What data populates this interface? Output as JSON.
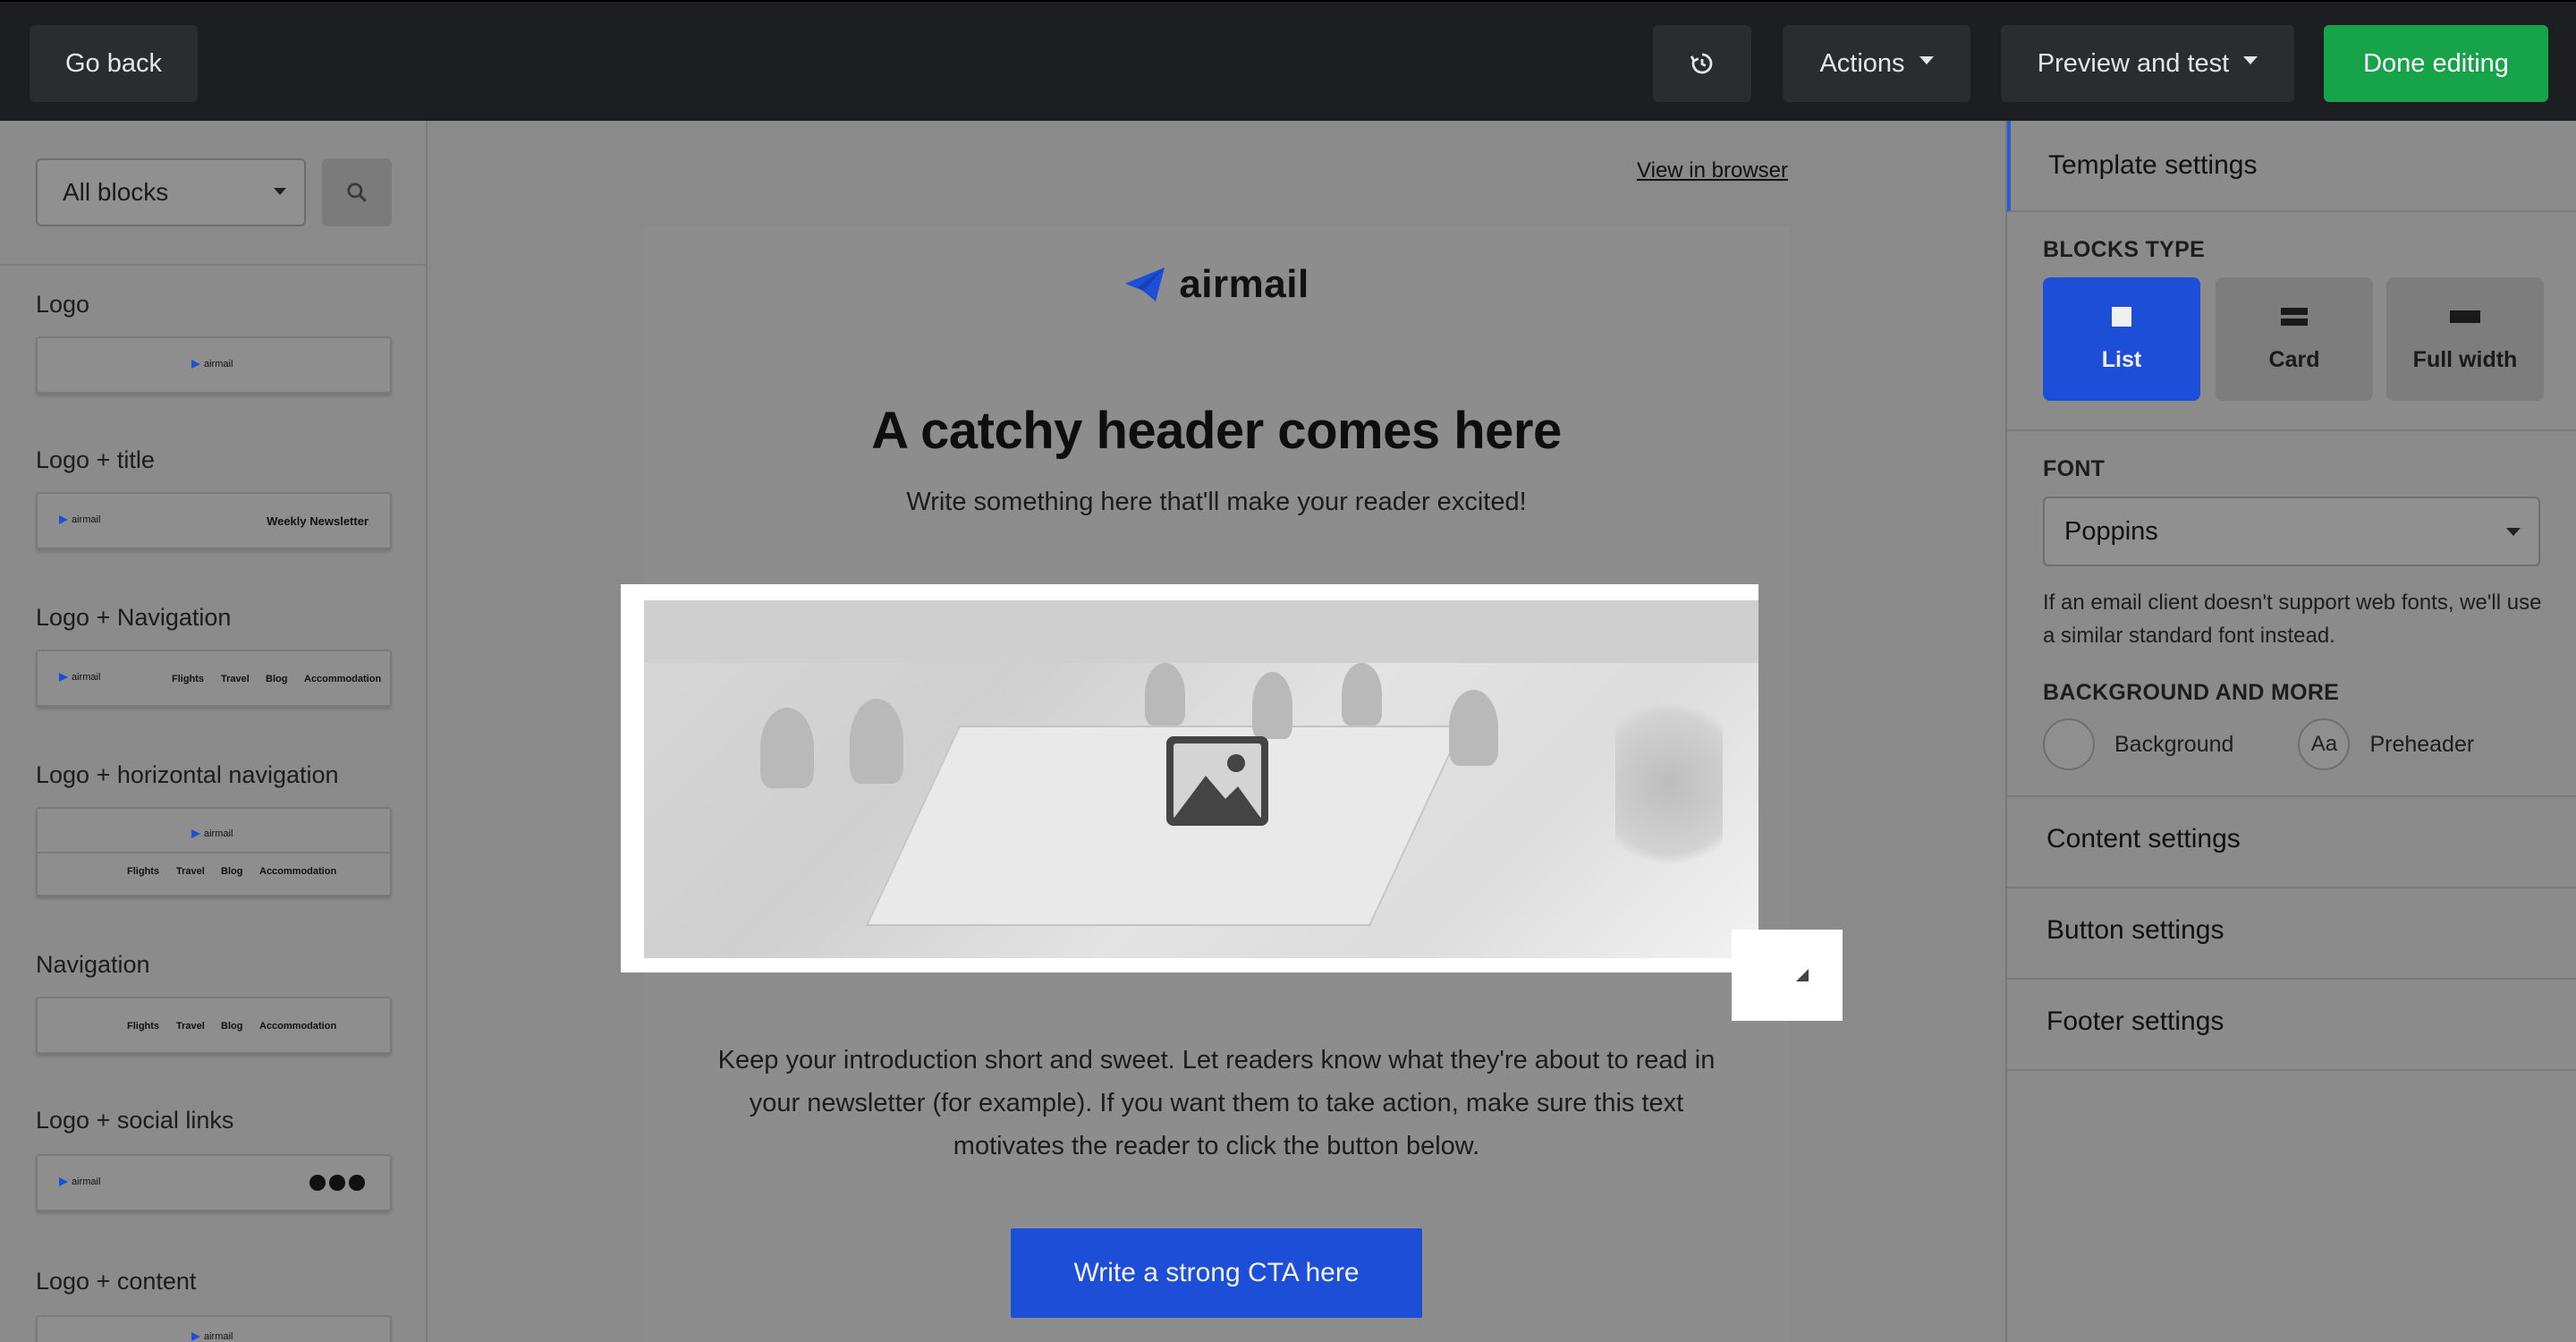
{
  "topbar": {
    "go_back": "Go back",
    "actions": "Actions",
    "preview": "Preview and test",
    "done": "Done editing"
  },
  "left_panel": {
    "filter_value": "All blocks",
    "blocks": [
      {
        "label": "Logo"
      },
      {
        "label": "Logo + title",
        "extra": "Weekly Newsletter"
      },
      {
        "label": "Logo + Navigation"
      },
      {
        "label": "Logo + horizontal navigation"
      },
      {
        "label": "Navigation"
      },
      {
        "label": "Logo + social links"
      },
      {
        "label": "Logo + content"
      }
    ],
    "mini_logo_text": "airmail",
    "nav_items": [
      "Flights",
      "Travel",
      "Blog",
      "Accommodation"
    ]
  },
  "email": {
    "view_in_browser": "View in browser",
    "brand": "airmail",
    "headline": "A catchy header comes here",
    "subhead": "Write something here that'll make your reader excited!",
    "intro": "Keep your introduction short and sweet. Let readers know what they're about to read in your newsletter (for example). If you want them to take action, make sure this text motivates the reader to click the button below.",
    "cta": "Write a strong CTA here"
  },
  "right_panel": {
    "title": "Template settings",
    "blocks_type_label": "BLOCKS TYPE",
    "types": [
      {
        "label": "List",
        "active": true
      },
      {
        "label": "Card",
        "active": false
      },
      {
        "label": "Full width",
        "active": false
      }
    ],
    "font_label": "FONT",
    "font_value": "Poppins",
    "font_hint": "If an email client doesn't support web fonts, we'll use a similar standard font instead.",
    "bg_label": "BACKGROUND AND MORE",
    "background": "Background",
    "preheader": "Preheader",
    "preheader_icon_text": "Aa",
    "content_settings": "Content settings",
    "button_settings": "Button settings",
    "footer_settings": "Footer settings"
  },
  "colors": {
    "accent": "#1d4ed8",
    "done_green": "#16a34a",
    "topbar": "#1c1e21"
  }
}
